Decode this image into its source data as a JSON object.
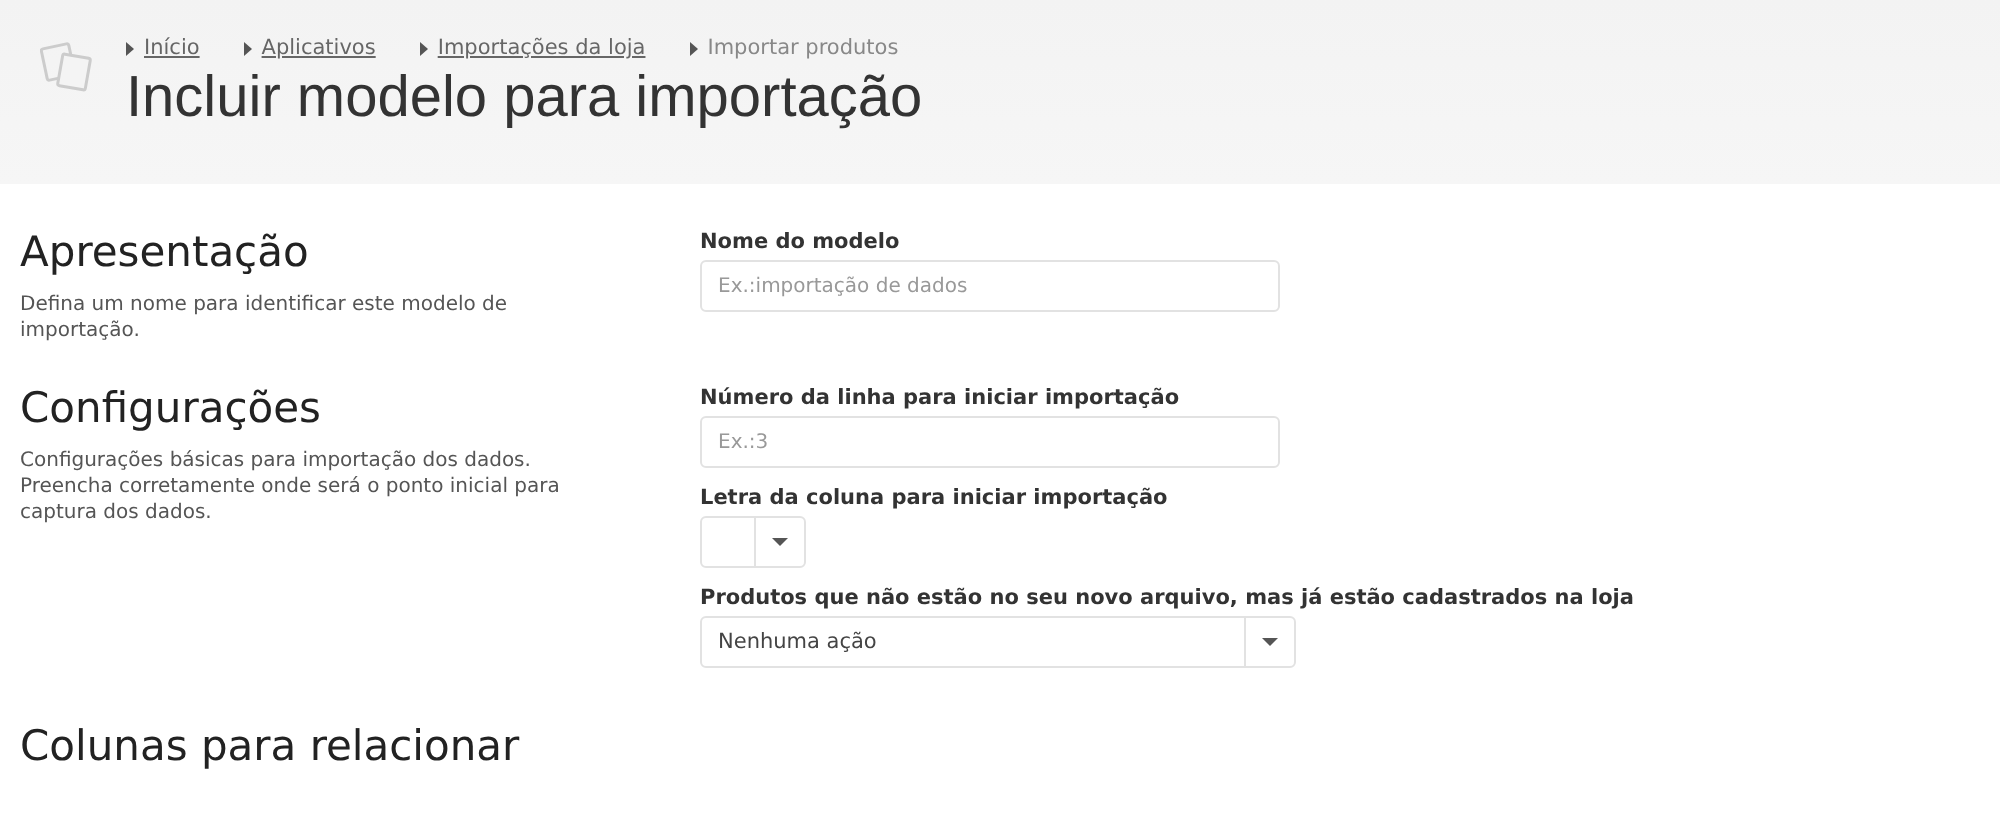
{
  "breadcrumb": [
    {
      "label": "Início",
      "current": false
    },
    {
      "label": "Aplicativos",
      "current": false
    },
    {
      "label": "Importações da loja",
      "current": false
    },
    {
      "label": "Importar produtos",
      "current": true
    }
  ],
  "page_title": "Incluir modelo para importação",
  "sections": [
    {
      "title": "Apresentação",
      "description": "Defina um nome para identificar este modelo de importação.",
      "fields": [
        {
          "kind": "text",
          "label": "Nome do modelo",
          "placeholder": "Ex.:importação de dados"
        }
      ]
    },
    {
      "title": "Configurações",
      "description": "Configurações básicas para importação dos dados. Preencha corretamente onde será o ponto inicial para captura dos dados.",
      "fields": [
        {
          "kind": "text",
          "label": "Número da linha para iniciar importação",
          "placeholder": "Ex.:3"
        },
        {
          "kind": "select-small",
          "label": "Letra da coluna para iniciar importação"
        },
        {
          "kind": "select",
          "label": "Produtos que não estão no seu novo arquivo, mas já estão cadastrados na loja",
          "value": "Nenhuma ação"
        }
      ]
    },
    {
      "title": "Colunas para relacionar"
    }
  ]
}
